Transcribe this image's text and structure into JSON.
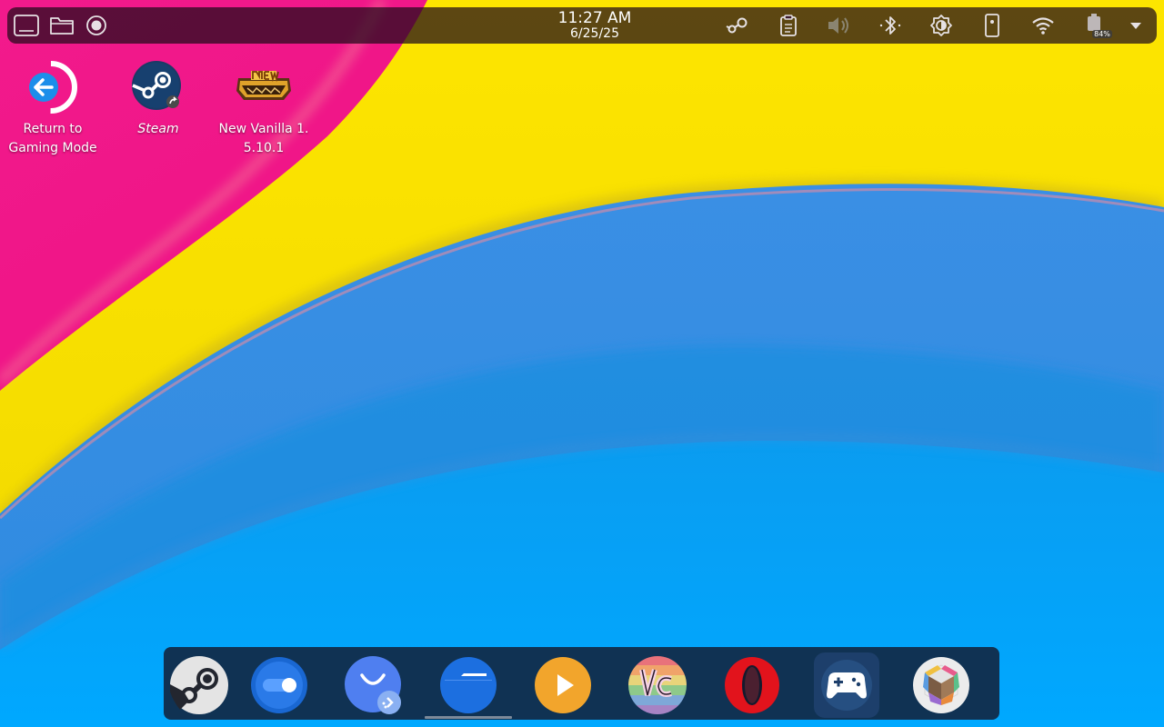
{
  "top_panel": {
    "time": "11:27 AM",
    "date": "6/25/25",
    "battery_percent": "84%",
    "icons": [
      "show-desktop-icon",
      "file-manager-icon",
      "record-icon",
      "steam-tray-icon",
      "clipboard-icon",
      "volume-icon",
      "bluetooth-icon",
      "brightness-icon",
      "kde-connect-icon",
      "wifi-icon",
      "battery-icon",
      "panel-expand-icon"
    ]
  },
  "desktop_icons": [
    {
      "label": "Return to Gaming Mode",
      "icon": "return-arrow-icon"
    },
    {
      "label": "Steam",
      "icon": "steam-icon"
    },
    {
      "label": "New Vanilla 1. 5.10.1",
      "icon": "new-vanilla-logo-icon"
    }
  ],
  "dock": {
    "apps": [
      "Steam",
      "Toggle",
      "Discover",
      "Dolphin",
      "Media Player",
      "VC",
      "Opera",
      "Game Controller",
      "Package"
    ],
    "active_index": 3
  },
  "colors": {
    "pink": "#ef0f86",
    "yellow": "#f9e000",
    "blue_mid": "#3d95e6",
    "blue_light": "#01a6ff",
    "panel_bg": "#2a0e20",
    "dock_bg": "#141a2d"
  }
}
